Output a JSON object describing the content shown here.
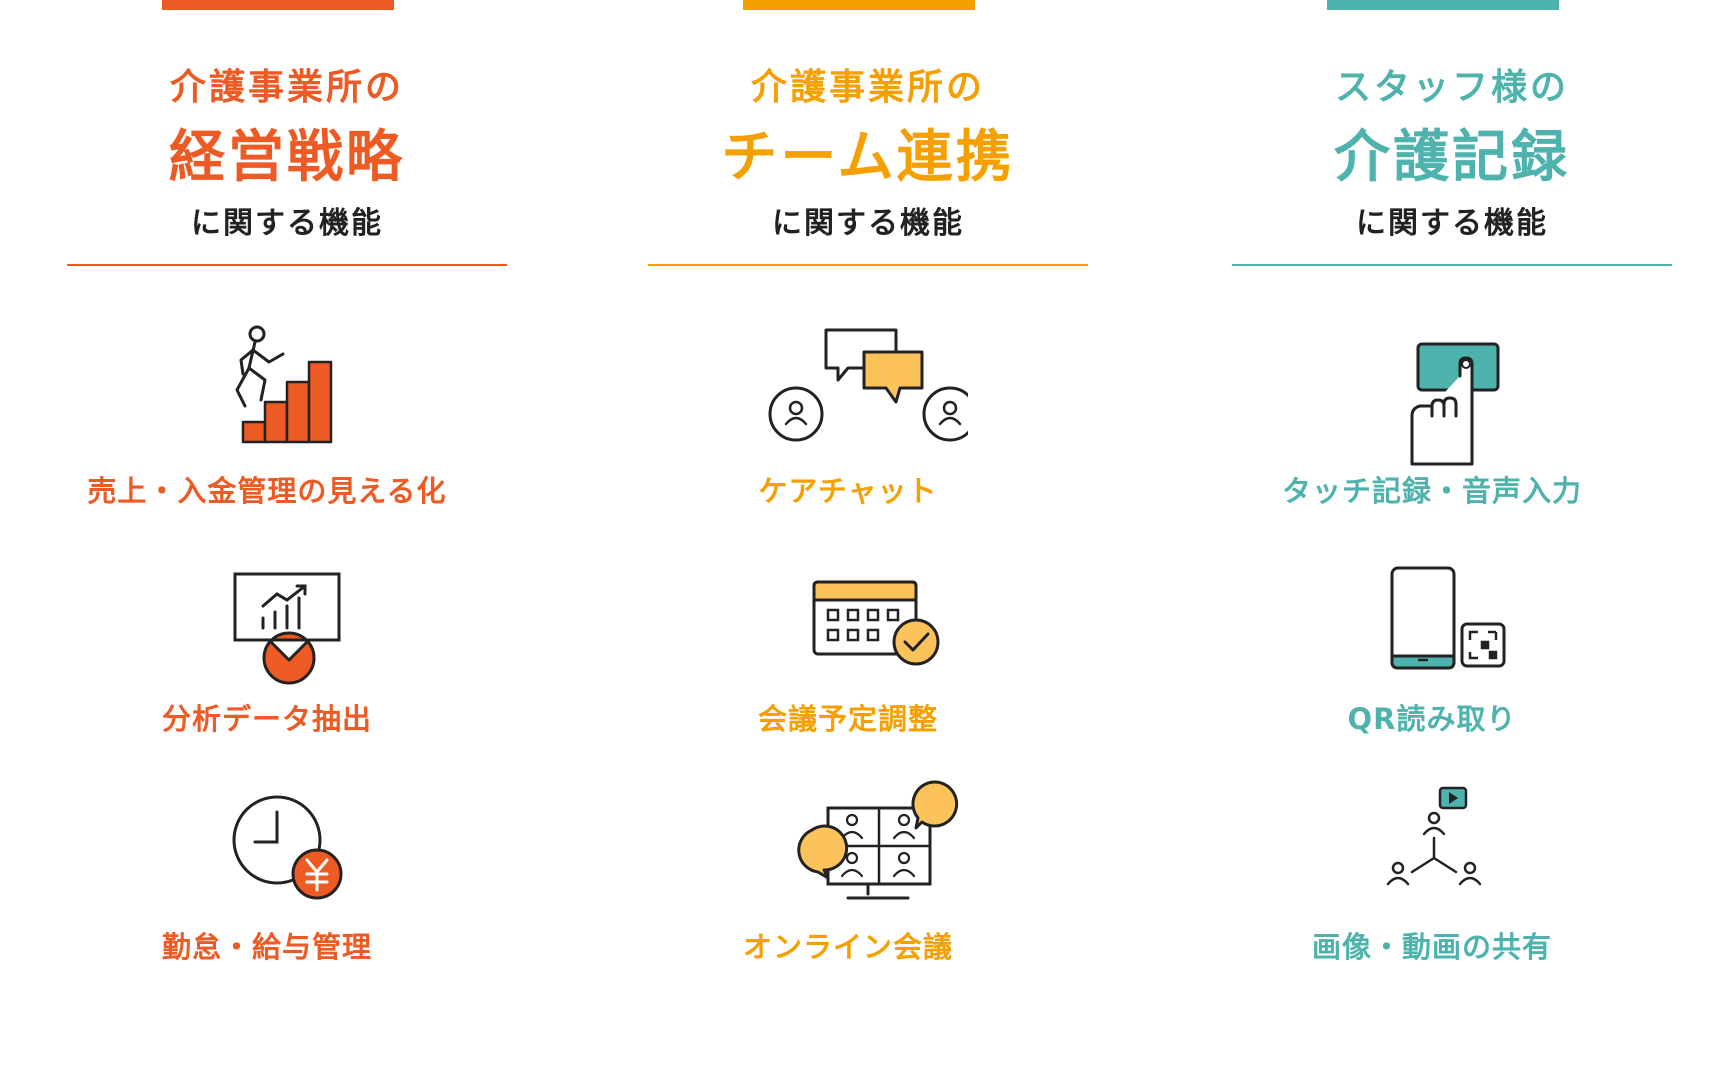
{
  "colors": {
    "orange_red": "#ee5a24",
    "orange": "#f5a000",
    "orange_fill": "#fcc35a",
    "teal": "#4fb3ad",
    "text": "#222222"
  },
  "columns": [
    {
      "heading_small": "介護事業所の",
      "heading_big": "経営戦略",
      "heading_sub": "に関する機能",
      "features": [
        {
          "label": "売上・入金管理の見える化",
          "icon": "stairs-climber-icon"
        },
        {
          "label": "分析データ抽出",
          "icon": "chart-board-icon"
        },
        {
          "label": "勤怠・給与管理",
          "icon": "clock-yen-icon"
        }
      ]
    },
    {
      "heading_small": "介護事業所の",
      "heading_big": "チーム連携",
      "heading_sub": "に関する機能",
      "features": [
        {
          "label": "ケアチャット",
          "icon": "chat-bubbles-icon"
        },
        {
          "label": "会議予定調整",
          "icon": "calendar-check-icon"
        },
        {
          "label": "オンライン会議",
          "icon": "video-meeting-icon"
        }
      ]
    },
    {
      "heading_small": "スタッフ様の",
      "heading_big": "介護記録",
      "heading_sub": "に関する機能",
      "features": [
        {
          "label": "タッチ記録・音声入力",
          "icon": "touch-hand-icon"
        },
        {
          "label": "QR読み取り",
          "icon": "tablet-qr-icon"
        },
        {
          "label": "画像・動画の共有",
          "icon": "share-network-icon"
        }
      ]
    }
  ]
}
